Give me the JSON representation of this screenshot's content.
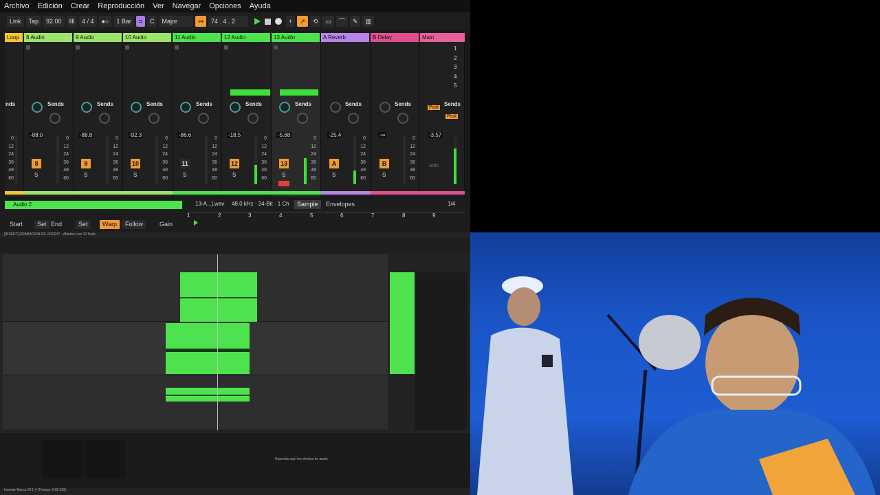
{
  "menu": [
    "Archivo",
    "Edición",
    "Crear",
    "Reproducción",
    "Ver",
    "Navegar",
    "Opciones",
    "Ayuda"
  ],
  "transport": {
    "link": "Link",
    "tap": "Tap",
    "tempo": "92.00",
    "signature": "4 / 4",
    "quantize": "1 Bar",
    "key": "C",
    "scale": "Major",
    "position": "74 .  4 .  2"
  },
  "tracks": [
    {
      "name": "Loop",
      "color": "#f5c531"
    },
    {
      "name": "8 Audio",
      "color": "#9ee36b",
      "num": "8",
      "vol": "-88.0"
    },
    {
      "name": "9 Audio",
      "color": "#9ee36b",
      "num": "9",
      "vol": "-88.8"
    },
    {
      "name": "10 Audio",
      "color": "#9ee36b",
      "num": "10",
      "vol": "-92.3"
    },
    {
      "name": "11 Audio",
      "color": "#4ee34e",
      "num": "11",
      "vol": "-86.6"
    },
    {
      "name": "12 Audio",
      "color": "#4ee34e",
      "num": "12",
      "vol": "-18.5"
    },
    {
      "name": "13 Audio",
      "color": "#4ee34e",
      "num": "13",
      "vol": "-5.68"
    },
    {
      "name": "A Reverb",
      "color": "#b884e6",
      "num": "A",
      "vol": "-25.4"
    },
    {
      "name": "B Delay",
      "color": "#e0508e",
      "num": "B",
      "vol": "-∞"
    },
    {
      "name": "Main",
      "color": "#e8609a",
      "vol": "-3.57"
    }
  ],
  "scenes": [
    "1",
    "2",
    "3",
    "4",
    "5"
  ],
  "sends_label": "Sends",
  "sends_partial": "nds",
  "knob_a": "A",
  "knob_b": "B",
  "solo_label": "S",
  "post_label": "Post",
  "solo_word": "Solo",
  "db_scale": [
    "0",
    "12",
    "24",
    "36",
    "48",
    "60"
  ],
  "clip": {
    "name": "Audio 2",
    "file": "13-A...].wav",
    "format": "48.0 kHz · 24-Bit · 1 Ch",
    "tab_sample": "Sample",
    "tab_envelopes": "Envelopes",
    "page": "1/4",
    "start": "Start",
    "set": "Set",
    "end": "End",
    "warp": "Warp",
    "follow": "Follow",
    "gain": "Gain",
    "ruler": [
      "1",
      "2",
      "3",
      "4",
      "5",
      "6",
      "7",
      "8",
      "9"
    ]
  },
  "lower": {
    "title": "[INSERT] GRABACION DE VOCES* - Ableton Live 12 Suite",
    "drop_text": "Deposita aquí los efectos de audio",
    "status": "Insertar Marca  Of 1 4  (Tiempo: 0:05.028)"
  }
}
